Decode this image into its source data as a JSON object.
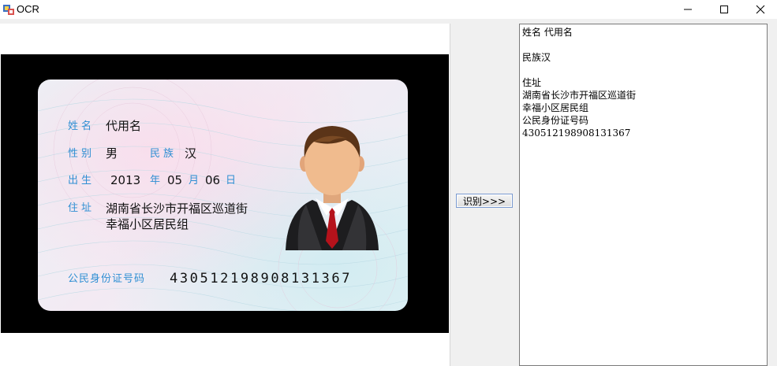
{
  "window": {
    "title": "OCR",
    "icons": {
      "app": "app-icon",
      "minimize": "minimize-icon",
      "maximize": "maximize-icon",
      "close": "close-icon"
    }
  },
  "id_card": {
    "name_label": "姓名",
    "name_value": "代用名",
    "sex_label": "性别",
    "sex_value": "男",
    "ethnicity_label": "民族",
    "ethnicity_value": "汉",
    "birth_label": "出生",
    "birth_year": "2013",
    "year_label": "年",
    "birth_month": "05",
    "month_label": "月",
    "birth_day": "06",
    "day_label": "日",
    "address_label": "住址",
    "address_line1": "湖南省长沙市开福区巡道街",
    "address_line2": "幸福小区居民组",
    "id_label": "公民身份证号码",
    "id_number": "430512198908131367",
    "portrait": "person-portrait-icon"
  },
  "actions": {
    "recognize_label": "识别>>>"
  },
  "result": {
    "lines": [
      "姓名 代用名",
      "",
      "民族汉",
      "",
      "住址",
      "湖南省长沙市开福区巡道街",
      "幸福小区居民组",
      "公民身份证号码",
      "430512198908131367"
    ]
  }
}
